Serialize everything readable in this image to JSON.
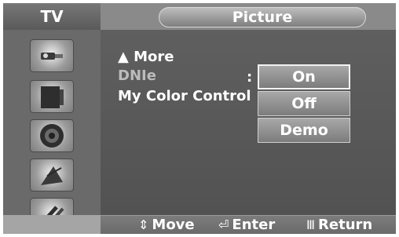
{
  "header": {
    "source_tab": "TV",
    "menu_title": "Picture"
  },
  "sidebar": {
    "icons": [
      "input-plug-icon",
      "picture-screen-icon",
      "speaker-sound-icon",
      "satellite-channel-icon",
      "setup-tools-icon"
    ]
  },
  "menu": {
    "items": [
      {
        "label": "More",
        "glyph": "▲"
      },
      {
        "label": "DNIe"
      },
      {
        "label": "My Color Control"
      }
    ],
    "separator": ":"
  },
  "popup": {
    "options": [
      "On",
      "Off",
      "Demo"
    ],
    "selected": "On"
  },
  "footer": {
    "move": {
      "glyph": "⇕",
      "label": "Move"
    },
    "enter": {
      "glyph": "⏎",
      "label": "Enter"
    },
    "return": {
      "glyph": "Ⅲ",
      "label": "Return"
    }
  }
}
